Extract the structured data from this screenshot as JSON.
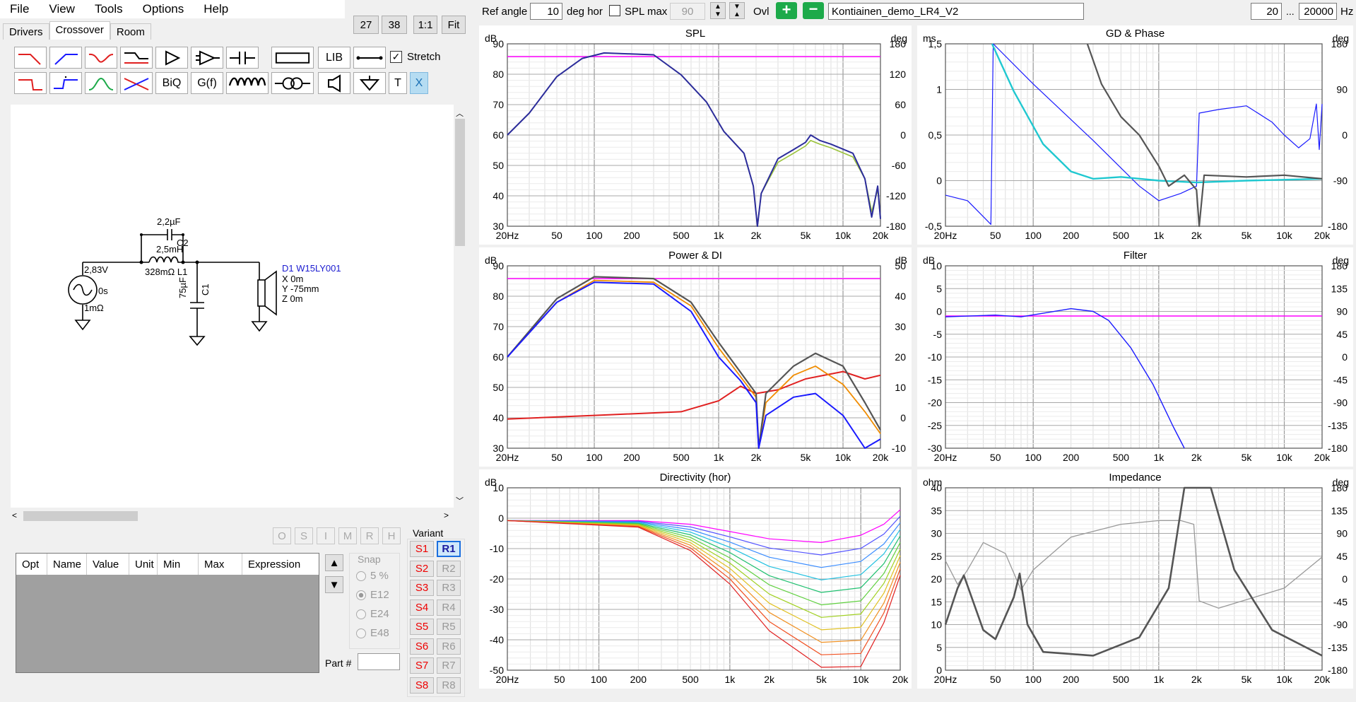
{
  "menu": [
    "File",
    "View",
    "Tools",
    "Options",
    "Help"
  ],
  "top_buttons": [
    "27",
    "38",
    "1:1",
    "Fit"
  ],
  "tabs": [
    "Drivers",
    "Crossover",
    "Room"
  ],
  "palette": {
    "lib": "LIB",
    "biq": "BiQ",
    "gf": "G(f)",
    "t": "T",
    "x": "X",
    "stretch": "Stretch"
  },
  "schematic": {
    "source_v": "2,83V",
    "source_delay": "0s",
    "source_r": "1mΩ",
    "c2": "2,2µF",
    "c2_name": "C2",
    "l1": "2,5mH",
    "l1_sub": "328mΩ L1",
    "c1": "75µF",
    "c1_name": "C1",
    "driver_name": "D1 W15LY001",
    "driver_x": "X 0m",
    "driver_y": "Y -75mm",
    "driver_z": "Z 0m"
  },
  "opt_buttons": [
    "O",
    "S",
    "I",
    "M",
    "R",
    "H"
  ],
  "opt_columns": [
    "Opt",
    "Name",
    "Value",
    "Unit",
    "Min",
    "Max",
    "Expression"
  ],
  "snap": {
    "label": "Snap",
    "options": [
      "5 %",
      "E12",
      "E24",
      "E48"
    ],
    "selected": "E12"
  },
  "part_label": "Part #",
  "variant": {
    "label": "Variant",
    "s": [
      "S1",
      "S2",
      "S3",
      "S4",
      "S5",
      "S6",
      "S7",
      "S8"
    ],
    "r": [
      "R1",
      "R2",
      "R3",
      "R4",
      "R5",
      "R6",
      "R7",
      "R8"
    ],
    "active_r": "R1"
  },
  "toolbar": {
    "ref_angle_label": "Ref angle",
    "ref_angle": "10",
    "deg_hor": "deg hor",
    "spl_max_label": "SPL max",
    "spl_max": "90",
    "ovl": "Ovl",
    "project_name": "Kontiainen_demo_LR4_V2",
    "f_min": "20",
    "dots": "...",
    "f_max": "20000",
    "hz": "Hz"
  },
  "colors": {
    "magenta": "#ff00ff",
    "navy": "#2c2c9c",
    "olive": "#9ac23a",
    "red": "#e02020",
    "orange": "#f08c00",
    "blue": "#1a1aff",
    "darkgray": "#555555",
    "cyan": "#20c8d0",
    "accent_green": "#1daa4a"
  },
  "x_ticks": [
    "20Hz",
    "50",
    "100",
    "200",
    "500",
    "1k",
    "2k",
    "5k",
    "10k",
    "20k"
  ],
  "graphs": [
    {
      "title": "SPL",
      "unit_left": "dB",
      "unit_right": "deg",
      "yl": [
        "90",
        "80",
        "70",
        "60",
        "50",
        "40",
        "30"
      ],
      "yr": [
        "180",
        "120",
        "60",
        "0",
        "-60",
        "-120",
        "-180"
      ]
    },
    {
      "title": "GD & Phase",
      "unit_left": "ms",
      "unit_right": "deg",
      "yl": [
        "1,5",
        "1",
        "0,5",
        "0",
        "-0,5"
      ],
      "yr": [
        "180",
        "90",
        "0",
        "-90",
        "-180"
      ]
    },
    {
      "title": "Power & DI",
      "unit_left": "dB",
      "unit_right": "dB",
      "yl": [
        "90",
        "80",
        "70",
        "60",
        "50",
        "40",
        "30"
      ],
      "yr": [
        "50",
        "40",
        "30",
        "20",
        "10",
        "0",
        "-10"
      ]
    },
    {
      "title": "Filter",
      "unit_left": "dB",
      "unit_right": "deg",
      "yl": [
        "10",
        "5",
        "0",
        "-5",
        "-10",
        "-15",
        "-20",
        "-25",
        "-30"
      ],
      "yr": [
        "180",
        "135",
        "90",
        "45",
        "0",
        "-45",
        "-90",
        "-135",
        "-180"
      ]
    },
    {
      "title": "Directivity (hor)",
      "unit_left": "dB",
      "unit_right": "",
      "yl": [
        "10",
        "0",
        "-10",
        "-20",
        "-30",
        "-40",
        "-50"
      ],
      "yr": []
    },
    {
      "title": "Impedance",
      "unit_left": "ohm",
      "unit_right": "deg",
      "yl": [
        "40",
        "35",
        "30",
        "25",
        "20",
        "15",
        "10",
        "5",
        "0"
      ],
      "yr": [
        "180",
        "135",
        "90",
        "45",
        "0",
        "-45",
        "-90",
        "-135",
        "-180"
      ]
    }
  ]
}
